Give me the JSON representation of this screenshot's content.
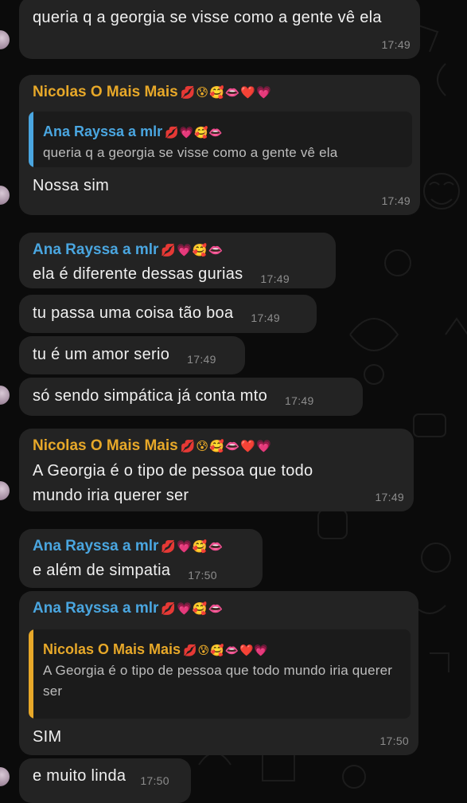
{
  "colors": {
    "background": "#0b0b0b",
    "bubble": "#232323",
    "nicolas_name": "#e7a829",
    "ana_name": "#4aa6e0",
    "timestamp": "#8d8d8d"
  },
  "messages": [
    {
      "text": "queria q a georgia se visse como a gente vê ela",
      "time": "17:49"
    },
    {
      "sender": "Nicolas O Mais Mais",
      "sender_emoji": "💋😰🥰👄❤️💗",
      "reply": {
        "sender": "Ana Rayssa a mlr",
        "sender_emoji": "💋💗🥰👄",
        "text": "queria q a georgia se visse como a gente vê ela"
      },
      "text": "Nossa sim",
      "time": "17:49"
    },
    {
      "sender": "Ana Rayssa a mlr",
      "sender_emoji": "💋💗🥰👄",
      "text": "ela é diferente dessas gurias",
      "time": "17:49"
    },
    {
      "text": "tu passa uma coisa tão boa",
      "time": "17:49"
    },
    {
      "text": "tu é um amor serio",
      "time": "17:49"
    },
    {
      "text": "só sendo simpática já conta mto",
      "time": "17:49"
    },
    {
      "sender": "Nicolas O Mais Mais",
      "sender_emoji": "💋😰🥰👄❤️💗",
      "text": "A Georgia é o tipo de pessoa que todo mundo iria querer ser",
      "time": "17:49"
    },
    {
      "sender": "Ana Rayssa a mlr",
      "sender_emoji": "💋💗🥰👄",
      "text": "e além de simpatia",
      "time": "17:50"
    },
    {
      "sender": "Ana Rayssa a mlr",
      "sender_emoji": "💋💗🥰👄",
      "reply": {
        "sender": "Nicolas O Mais Mais",
        "sender_emoji": "💋😰🥰👄❤️💗",
        "text": "A Georgia é o tipo de pessoa que todo mundo iria querer ser"
      },
      "text": "SIM",
      "time": "17:50"
    },
    {
      "text": "e muito linda",
      "time": "17:50"
    }
  ]
}
